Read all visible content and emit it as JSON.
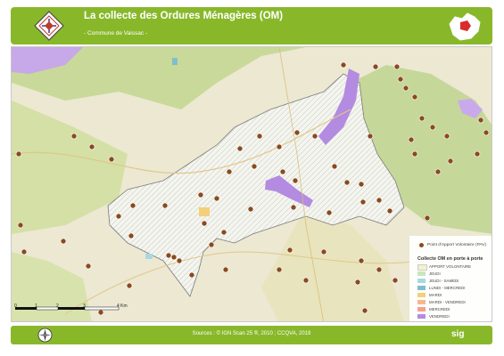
{
  "header": {
    "title": "La collecte des Ordures Ménagères (OM)",
    "subtitle": "- Commune de Vaissac -"
  },
  "footer": {
    "sources": "Sources : © IGN Scan 25 ®, 2010 ; CCQVA, 2019",
    "brand": "sig"
  },
  "legend": {
    "poi_label": "Point d'Apport Volontaire (PAV)",
    "title": "Collecte OM en porte à porte",
    "items": [
      {
        "label": "APPORT VOLONTAIRE",
        "color": "#f4f2c8"
      },
      {
        "label": "JEUDI",
        "color": "#c8e6c0"
      },
      {
        "label": "JEUDI - SAMEDI",
        "color": "#a9d9e0"
      },
      {
        "label": "LUNDI - MERCREDI",
        "color": "#7fbfc9"
      },
      {
        "label": "MARDI",
        "color": "#f3d07a"
      },
      {
        "label": "MARDI - VENDREDI",
        "color": "#f5b98d"
      },
      {
        "label": "MERCREDI",
        "color": "#f6a08a"
      },
      {
        "label": "VENDREDI",
        "color": "#b38be0"
      }
    ]
  },
  "scale": {
    "ticks": [
      "0",
      "1",
      "2",
      "3",
      "4 Km"
    ]
  },
  "colors": {
    "banner": "#88b82a",
    "pav_point": "#8a4a20",
    "vendredi": "#b38be0"
  }
}
